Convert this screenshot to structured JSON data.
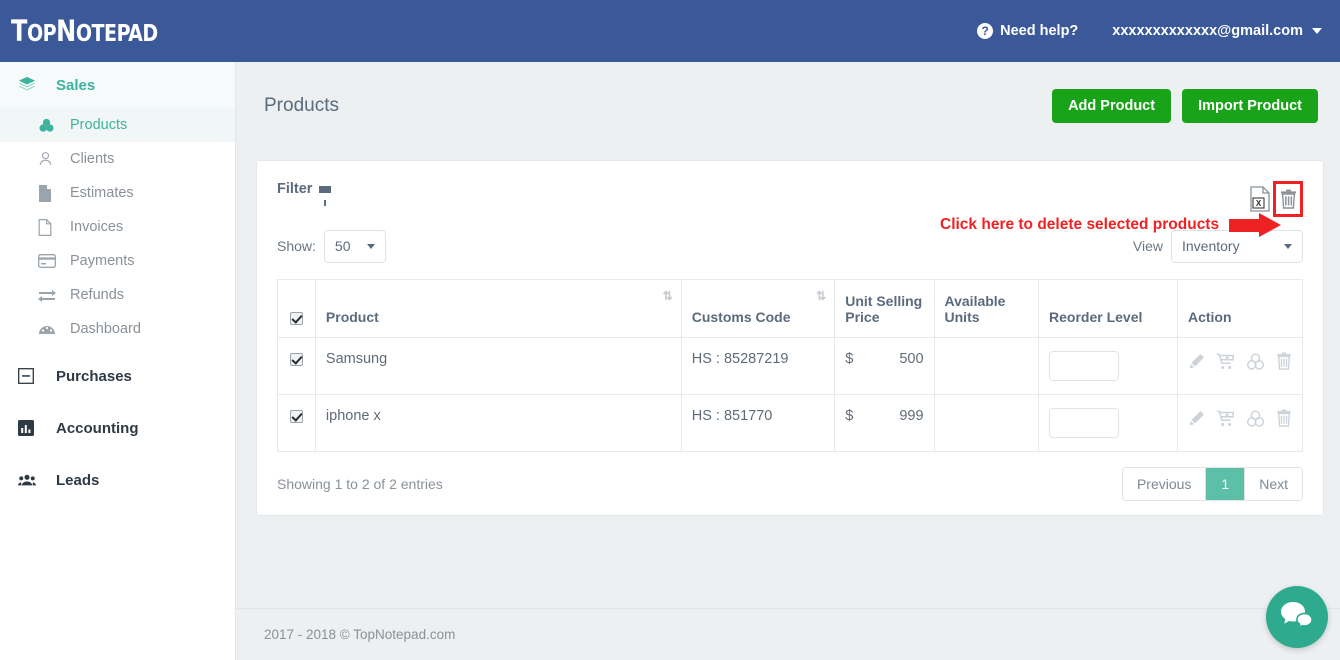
{
  "topbar": {
    "logo_top": "T",
    "logo_op": "OP",
    "logo_n": "N",
    "logo_otepad": "OTEPAD",
    "logo_full": "TopNotepad",
    "help_icon": "question-circle-icon",
    "help_label": "Need help?",
    "user_email": "xxxxxxxxxxxxx@gmail.com",
    "caret_icon": "caret-down-icon",
    "bg_color": "#3b5998"
  },
  "sidebar": {
    "items": [
      {
        "label": "Sales",
        "icon": "layers-icon",
        "level": "group",
        "active": true
      },
      {
        "label": "Products",
        "icon": "cubes-icon",
        "level": "sub",
        "active": true
      },
      {
        "label": "Clients",
        "icon": "user-icon",
        "level": "sub",
        "active": false
      },
      {
        "label": "Estimates",
        "icon": "file-filled-icon",
        "level": "sub",
        "active": false
      },
      {
        "label": "Invoices",
        "icon": "file-icon",
        "level": "sub",
        "active": false
      },
      {
        "label": "Payments",
        "icon": "credit-card-icon",
        "level": "sub",
        "active": false
      },
      {
        "label": "Refunds",
        "icon": "exchange-icon",
        "level": "sub",
        "active": false
      },
      {
        "label": "Dashboard",
        "icon": "dashboard-icon",
        "level": "sub",
        "active": false
      },
      {
        "label": "Purchases",
        "icon": "minus-square-icon",
        "level": "group",
        "active": false
      },
      {
        "label": "Accounting",
        "icon": "bar-chart-icon",
        "level": "group",
        "active": false
      },
      {
        "label": "Leads",
        "icon": "users-icon",
        "level": "group",
        "active": false
      }
    ],
    "active_color": "#3db39e"
  },
  "page": {
    "title": "Products",
    "add_product_label": "Add Product",
    "import_product_label": "Import Product",
    "button_color": "#19a319"
  },
  "panel": {
    "filter_label": "Filter",
    "filter_icon": "funnel-icon",
    "export_icon": "excel-export-icon",
    "delete_icon": "trash-icon",
    "show_label": "Show:",
    "show_value": "50",
    "view_label": "View",
    "view_value": "Inventory"
  },
  "annotation": {
    "text": "Click here to delete selected products",
    "color": "#ee2222",
    "arrow_icon": "right-arrow-icon"
  },
  "table": {
    "headers": [
      "",
      "Product",
      "Customs Code",
      "Unit Selling Price",
      "Available Units",
      "Reorder Level",
      "Action"
    ],
    "sort_icon": "sort-updown-icon",
    "header_checkbox_checked": true,
    "rows": [
      {
        "checked": true,
        "product": "Samsung",
        "customs_code": "HS : 85287219",
        "currency": "$",
        "unit_selling_price": "500",
        "available_units": "",
        "reorder_level": "",
        "actions": [
          "edit-pencil-icon",
          "cart-plus-icon",
          "cubes-icon",
          "trash-icon"
        ]
      },
      {
        "checked": true,
        "product": "iphone x",
        "customs_code": "HS : 851770",
        "currency": "$",
        "unit_selling_price": "999",
        "available_units": "",
        "reorder_level": "",
        "actions": [
          "edit-pencil-icon",
          "cart-plus-icon",
          "cubes-icon",
          "trash-icon"
        ]
      }
    ],
    "entries_text": "Showing 1 to 2 of 2 entries",
    "pagination": {
      "previous_label": "Previous",
      "pages": [
        "1"
      ],
      "active_page": "1",
      "next_label": "Next",
      "active_color": "#5bc0a7"
    }
  },
  "footer": {
    "text": "2017 - 2018 © TopNotepad.com"
  },
  "chat": {
    "icon": "chat-bubbles-icon",
    "color": "#2eab8f"
  }
}
